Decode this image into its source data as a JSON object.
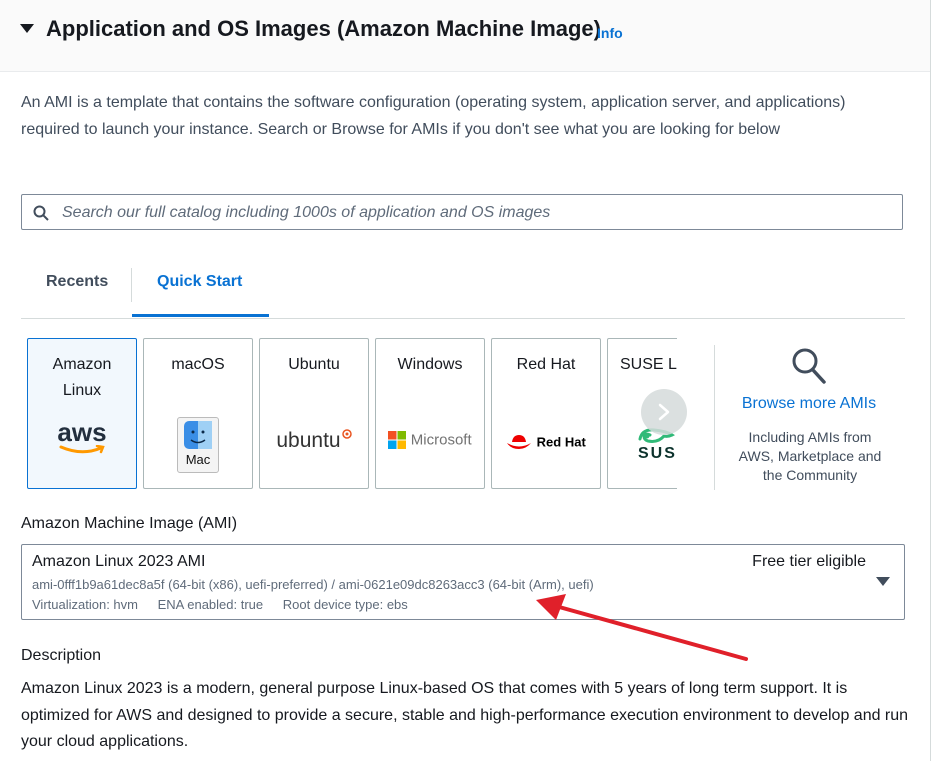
{
  "header": {
    "title": "Application and OS Images (Amazon Machine Image)",
    "info_label": "Info"
  },
  "intro_text": "An AMI is a template that contains the software configuration (operating system, application server, and applications) required to launch your instance. Search or Browse for AMIs if you don't see what you are looking for below",
  "search": {
    "placeholder": "Search our full catalog including 1000s of application and OS images",
    "value": ""
  },
  "tabs": [
    {
      "label": "Recents",
      "active": false
    },
    {
      "label": "Quick Start",
      "active": true
    }
  ],
  "os_cards": [
    {
      "label": "Amazon Linux",
      "logo_text": "aws",
      "icon": "aws-smile-logo",
      "selected": true
    },
    {
      "label": "macOS",
      "logo_text": "Mac",
      "icon": "mac-finder-icon",
      "selected": false
    },
    {
      "label": "Ubuntu",
      "logo_text": "ubuntu",
      "icon": "ubuntu-logo",
      "selected": false
    },
    {
      "label": "Windows",
      "logo_text": "Microsoft",
      "icon": "microsoft-logo",
      "selected": false
    },
    {
      "label": "Red Hat",
      "logo_text": "Red Hat",
      "icon": "redhat-logo",
      "selected": false
    },
    {
      "label": "SUSE Li",
      "logo_text": "SUSI",
      "icon": "suse-logo",
      "selected": false
    }
  ],
  "browse": {
    "link": "Browse more AMIs",
    "subtext": "Including AMIs from AWS, Marketplace and the Community",
    "icon": "search-icon"
  },
  "ami": {
    "label": "Amazon Machine Image (AMI)",
    "name": "Amazon Linux 2023 AMI",
    "badge": "Free tier eligible",
    "ids": "ami-0fff1b9a61dec8a5f (64-bit (x86), uefi-preferred) / ami-0621e09dc8263acc3 (64-bit (Arm), uefi)",
    "virtualization": "Virtualization: hvm",
    "ena": "ENA enabled: true",
    "root_device": "Root device type: ebs"
  },
  "description": {
    "label": "Description",
    "text": "Amazon Linux 2023 is a modern, general purpose Linux-based OS that comes with 5 years of long term support. It is optimized for AWS and designed to provide a secure, stable and high-performance execution environment to develop and run your cloud applications."
  },
  "colors": {
    "accent": "#0972d3",
    "annotation_arrow": "#e0202a"
  }
}
